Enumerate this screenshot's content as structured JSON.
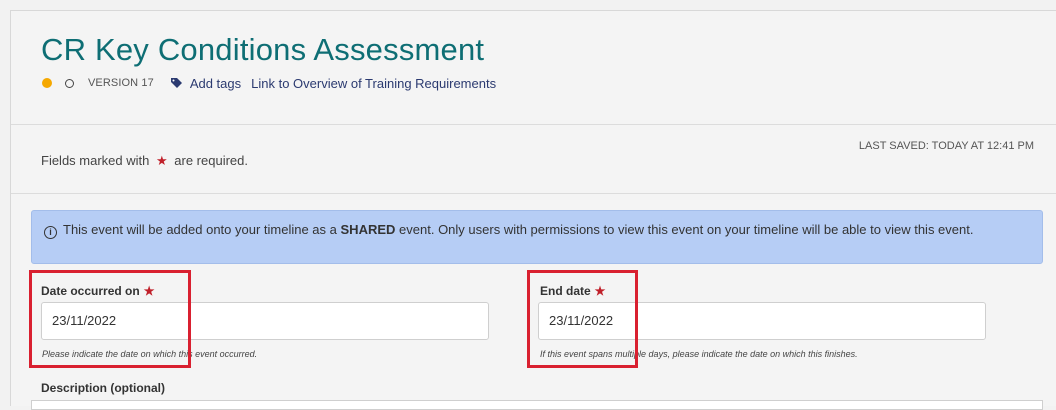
{
  "header": {
    "title": "CR Key Conditions Assessment",
    "version": "VERSION 17",
    "add_tags": "Add tags",
    "overview_link": "Link to Overview of Training Requirements",
    "status_color": "#f5a800"
  },
  "form_meta": {
    "required_prefix": "Fields marked with",
    "required_star": "★",
    "required_suffix": "are required.",
    "last_saved": "LAST SAVED: TODAY AT 12:41 PM"
  },
  "info_banner": {
    "icon": "info-icon",
    "text_before": "This event will be added onto your timeline as a",
    "text_bold": "SHARED",
    "text_after": "event. Only users with permissions to view this event on your timeline will be able to view this event."
  },
  "fields": {
    "date_occurred": {
      "label": "Date occurred on",
      "star": "★",
      "value": "23/11/2022",
      "hint": "Please indicate the date on which this event occurred."
    },
    "end_date": {
      "label": "End date",
      "star": "★",
      "value": "23/11/2022",
      "hint": "If this event spans multiple days, please indicate the date on which this finishes."
    },
    "description": {
      "label": "Description (optional)"
    }
  },
  "colors": {
    "title": "#0e6e74",
    "link": "#2b3a70",
    "required_star": "#c0202a",
    "banner": "#b6cdf5",
    "highlight": "#d92030"
  }
}
